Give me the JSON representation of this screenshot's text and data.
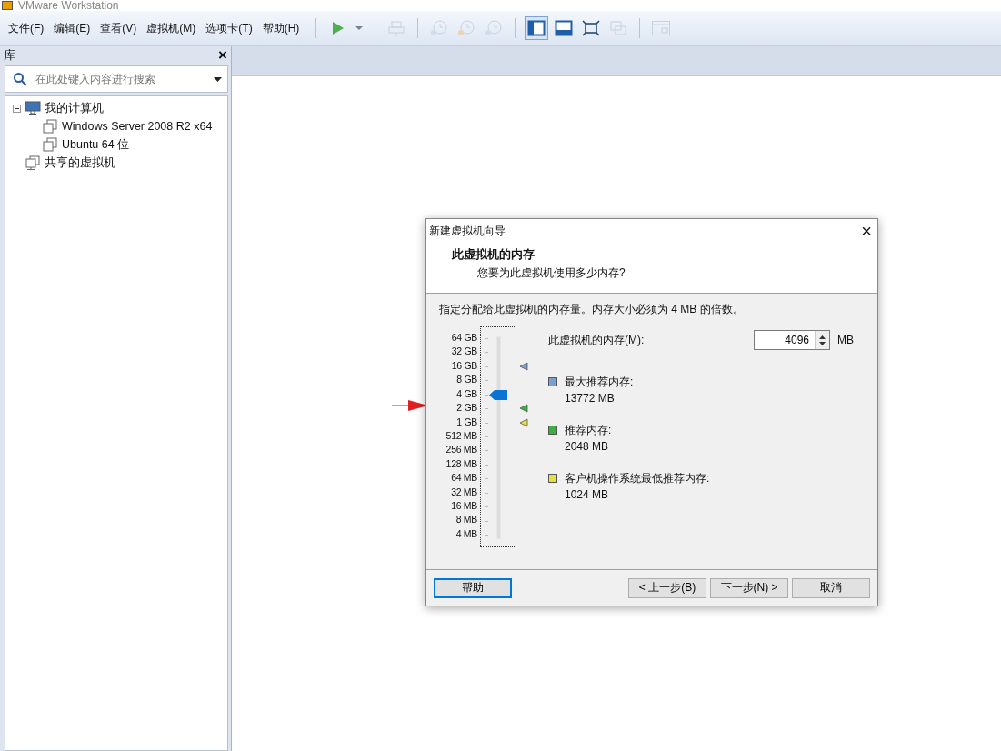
{
  "window": {
    "title": "VMware Workstation"
  },
  "menu": [
    "文件(F)",
    "编辑(E)",
    "查看(V)",
    "虚拟机(M)",
    "选项卡(T)",
    "帮助(H)"
  ],
  "toolbar": [
    {
      "kind": "play",
      "disabled": false,
      "selected": false
    },
    {
      "kind": "caret",
      "disabled": false,
      "selected": false
    },
    {
      "kind": "send",
      "disabled": true,
      "selected": false
    },
    {
      "kind": "clock-plus",
      "disabled": true,
      "selected": false
    },
    {
      "kind": "clock-back",
      "disabled": true,
      "selected": false
    },
    {
      "kind": "clock-search",
      "disabled": true,
      "selected": false
    },
    {
      "kind": "sidebar-view",
      "disabled": false,
      "selected": true
    },
    {
      "kind": "console-view",
      "disabled": false,
      "selected": false
    },
    {
      "kind": "fullscreen",
      "disabled": false,
      "selected": false
    },
    {
      "kind": "unity",
      "disabled": true,
      "selected": false
    },
    {
      "kind": "window",
      "disabled": true,
      "selected": false
    }
  ],
  "library": {
    "title": "库",
    "close": "×",
    "search": {
      "placeholder": "在此处键入内容进行搜索"
    },
    "tree": [
      {
        "label": "我的计算机",
        "kind": "computer",
        "expanded": true,
        "children": [
          {
            "label": "Windows Server 2008 R2 x64",
            "kind": "vm"
          },
          {
            "label": "Ubuntu 64 位",
            "kind": "vm"
          }
        ]
      },
      {
        "label": "共享的虚拟机",
        "kind": "shared"
      }
    ]
  },
  "dialog": {
    "title": "新建虚拟机向导",
    "close": "×",
    "heading": "此虚拟机的内存",
    "subheading": "您要为此虚拟机使用多少内存?",
    "instruction": "指定分配给此虚拟机的内存量。内存大小必须为 4 MB 的倍数。",
    "slider": {
      "labels": [
        "64 GB",
        "32 GB",
        "16 GB",
        "8 GB",
        "4 GB",
        "2 GB",
        "1 GB",
        "512 MB",
        "256 MB",
        "128 MB",
        "64 MB",
        "32 MB",
        "16 MB",
        "8 MB",
        "4 MB"
      ],
      "level": 0.714
    },
    "memory_label": "此虚拟机的内存(M):",
    "memory_value": "4096",
    "memory_unit": "MB",
    "recommendations": [
      {
        "label": "最大推荐内存:",
        "value": "13772 MB",
        "color": "#7a9fd0",
        "level": 0.857
      },
      {
        "label": "推荐内存:",
        "value": "2048 MB",
        "color": "#3cb043",
        "level": 0.643
      },
      {
        "label": "客户机操作系统最低推荐内存:",
        "value": "1024 MB",
        "color": "#e8e040",
        "level": 0.571
      }
    ],
    "buttons": [
      {
        "label": "帮助",
        "kind": "help",
        "focused": true
      },
      {
        "label": "< 上一步(B)",
        "kind": "back",
        "focused": false
      },
      {
        "label": "下一步(N) >",
        "kind": "next",
        "focused": false
      },
      {
        "label": "取消",
        "kind": "cancel",
        "focused": false
      }
    ]
  }
}
